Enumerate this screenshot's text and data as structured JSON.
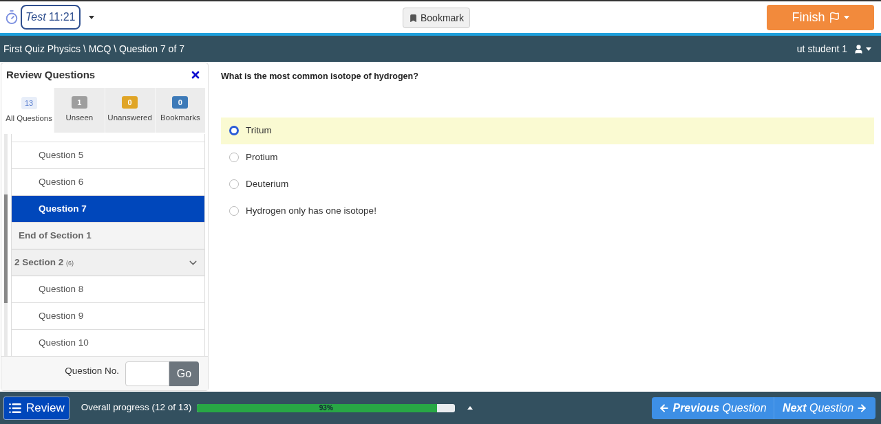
{
  "topbar": {
    "timer_label": "Test",
    "timer_value": "11:21",
    "bookmark": "Bookmark",
    "finish": "Finish"
  },
  "breadcrumb": "First Quiz Physics \\ MCQ \\ Question 7 of 7",
  "user": "ut student 1",
  "review_panel": {
    "title": "Review Questions",
    "tabs": [
      {
        "count": "13",
        "label": "All Questions",
        "color": "#e8eef9",
        "selected": true
      },
      {
        "count": "1",
        "label": "Unseen",
        "color": "#9e9e9e",
        "selected": false
      },
      {
        "count": "0",
        "label": "Unanswered",
        "color": "#e0a526",
        "selected": false
      },
      {
        "count": "0",
        "label": "Bookmarks",
        "color": "#3d7ab8",
        "selected": false
      }
    ],
    "items": [
      {
        "kind": "question",
        "label": "Question 5",
        "selected": false
      },
      {
        "kind": "question",
        "label": "Question 6",
        "selected": false
      },
      {
        "kind": "question",
        "label": "Question 7",
        "selected": true
      },
      {
        "kind": "section_end",
        "label": "End of Section 1"
      },
      {
        "kind": "section",
        "label": "2 Section 2",
        "count": "(6)",
        "expanded": true
      },
      {
        "kind": "question",
        "label": "Question 8",
        "selected": false
      },
      {
        "kind": "question",
        "label": "Question 9",
        "selected": false
      },
      {
        "kind": "question",
        "label": "Question 10",
        "selected": false
      }
    ],
    "goto_label": "Question No.",
    "go": "Go"
  },
  "question": {
    "text": "What is the most common isotope of hydrogen?",
    "options": [
      {
        "label": "Tritum",
        "selected": true
      },
      {
        "label": "Protium",
        "selected": false
      },
      {
        "label": "Deuterium",
        "selected": false
      },
      {
        "label": "Hydrogen only has one isotope!",
        "selected": false
      }
    ]
  },
  "footer": {
    "review": "Review",
    "progress_label": "Overall progress (12 of 13)",
    "progress": {
      "level": 0.93,
      "reading": "93%"
    },
    "previous": "**Previous** Question",
    "next": "**Next** Question"
  }
}
